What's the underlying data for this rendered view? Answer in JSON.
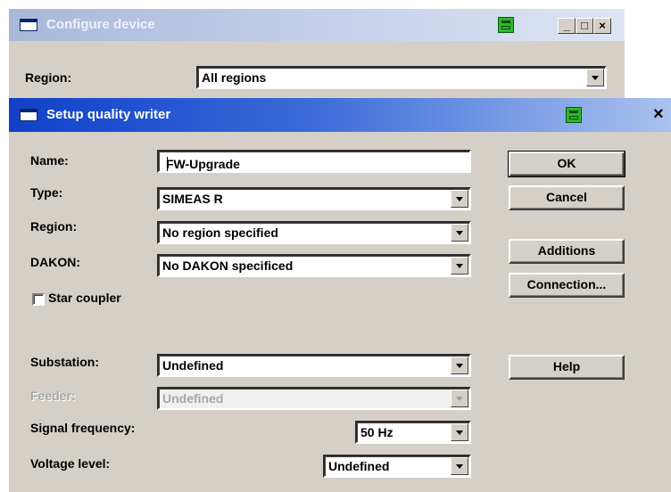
{
  "background_window": {
    "title": "Configure device",
    "region_label": "Region:",
    "region_value": "All regions"
  },
  "dialog": {
    "title": "Setup quality writer",
    "close_glyph": "×",
    "fields": {
      "name_label": "Name:",
      "name_value": "FW-Upgrade",
      "type_label": "Type:",
      "type_value": "SIMEAS R",
      "region_label": "Region:",
      "region_value": "No region specified",
      "dakon_label": "DAKON:",
      "dakon_value": "No DAKON specificed",
      "star_coupler_label": "Star coupler",
      "star_coupler_checked": false,
      "substation_label": "Substation:",
      "substation_value": "Undefined",
      "feeder_label": "Feeder:",
      "feeder_value": "Undefined",
      "signal_frequency_label": "Signal frequency:",
      "signal_frequency_value": "50 Hz",
      "voltage_level_label": "Voltage level:",
      "voltage_level_value": "Undefined"
    },
    "buttons": {
      "ok": "OK",
      "cancel": "Cancel",
      "additions": "Additions",
      "connection": "Connection...",
      "help": "Help"
    }
  },
  "caption_buttons": {
    "minimize": "_",
    "maximize": "□",
    "close": "×"
  },
  "colors": {
    "title_active": "#1040c8",
    "dialog_face": "#d4d0c8",
    "printer_icon": "#2fb52f"
  },
  "icons": [
    "window-icon",
    "printer-icon"
  ]
}
